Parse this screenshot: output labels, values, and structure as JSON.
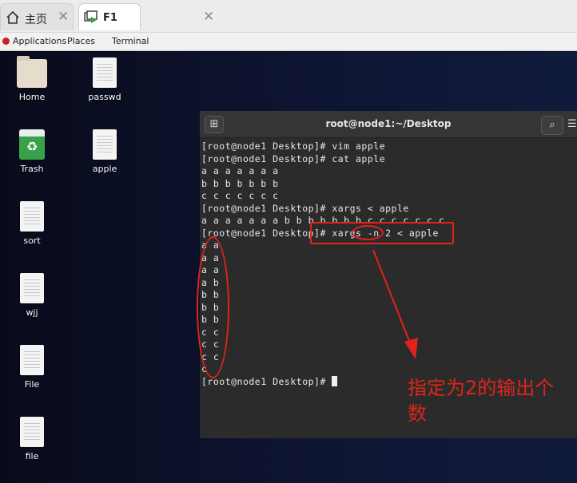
{
  "tabs": [
    {
      "label": "主页",
      "close": "✕"
    },
    {
      "label": "F1",
      "close": "✕"
    }
  ],
  "panel": {
    "applications": "Applications",
    "places": "Places",
    "terminal": "Terminal"
  },
  "desktop_icons": [
    {
      "label": "Home"
    },
    {
      "label": "passwd"
    },
    {
      "label": "Trash"
    },
    {
      "label": "apple"
    },
    {
      "label": "sort"
    },
    {
      "label": "wjj"
    },
    {
      "label": "File"
    },
    {
      "label": "file"
    }
  ],
  "terminal": {
    "title": "root@node1:~/Desktop",
    "lines": [
      "[root@node1 Desktop]# vim apple",
      "[root@node1 Desktop]# cat apple",
      "a a a a a a a",
      "b b b b b b b",
      "c c c c c c c",
      "[root@node1 Desktop]# xargs < apple",
      "a a a a a a a b b b b b b b c c c c c c c",
      "[root@node1 Desktop]# xargs -n 2 < apple",
      "a a",
      "a a",
      "a a",
      "a b",
      "b b",
      "b b",
      "b b",
      "c c",
      "c c",
      "c c",
      "c",
      "[root@node1 Desktop]# "
    ]
  },
  "annotation": {
    "text": "指定为2的输出个数",
    "color": "#e0241a"
  }
}
